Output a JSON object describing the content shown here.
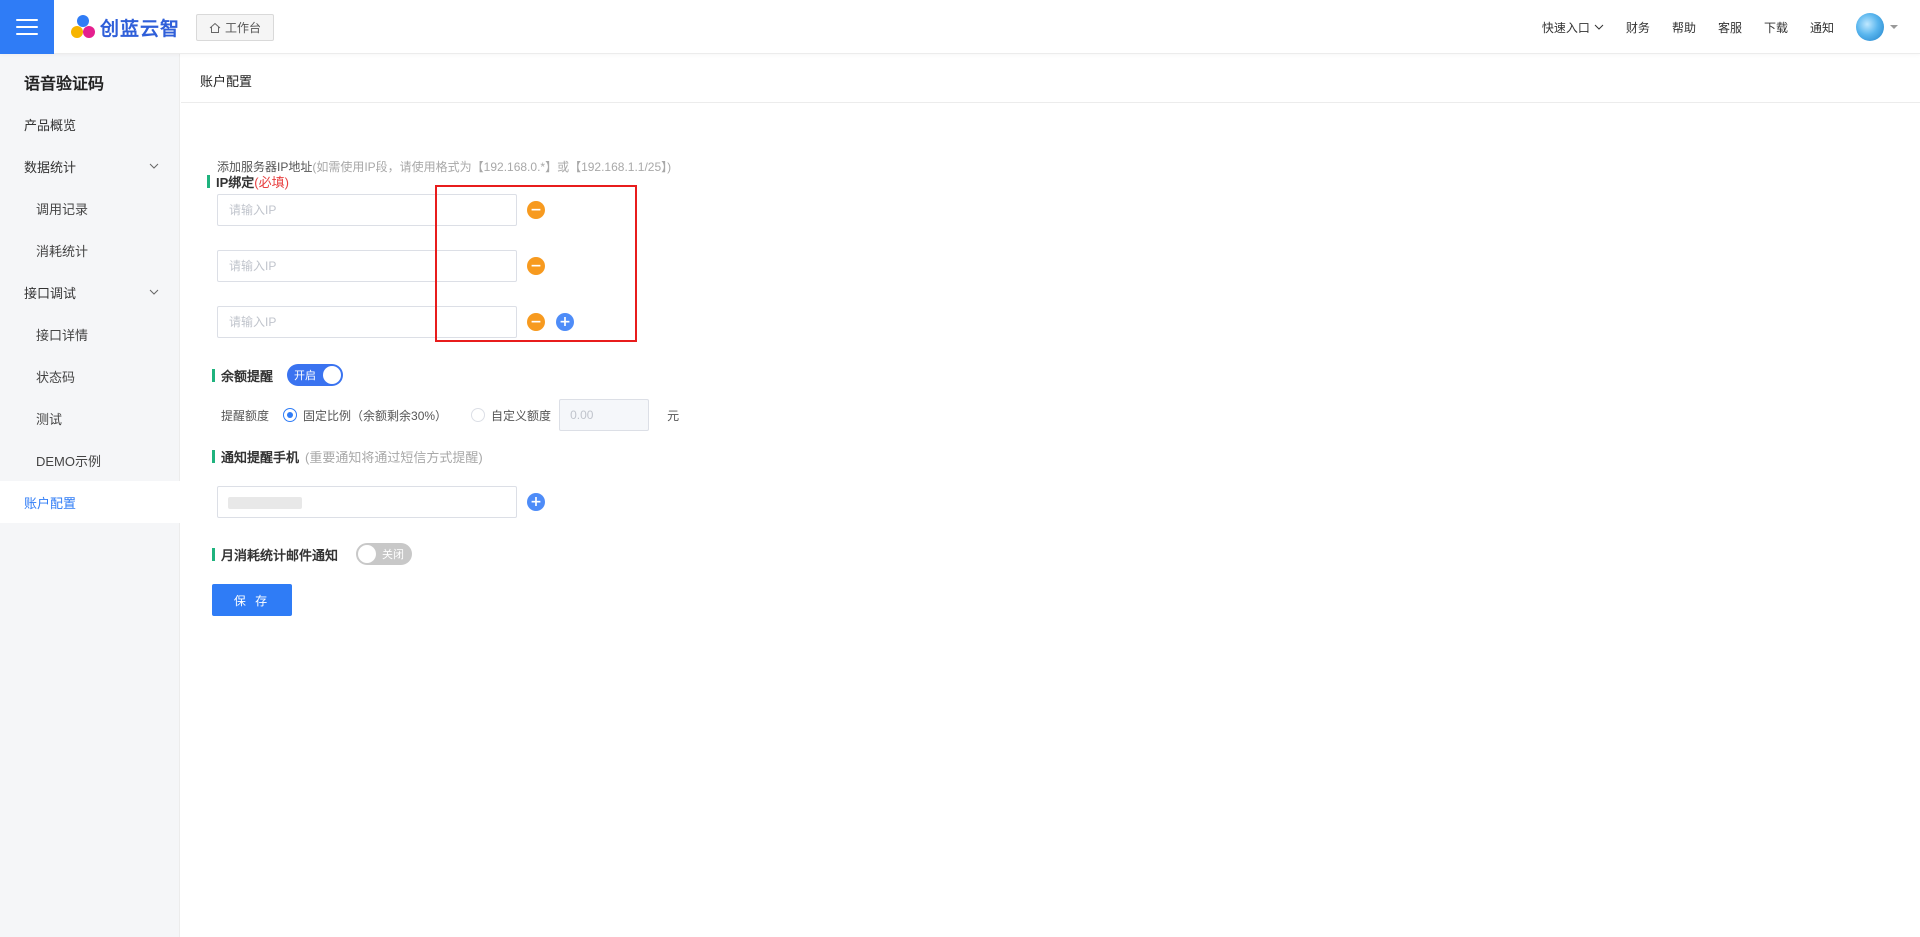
{
  "header": {
    "brand": "创蓝云智",
    "workbench_label": "工作台",
    "nav": {
      "quick_entry": "快速入口",
      "finance": "财务",
      "help": "帮助",
      "support": "客服",
      "download": "下载",
      "notice": "通知"
    }
  },
  "sidebar": {
    "title": "语音验证码",
    "items": [
      {
        "label": "产品概览"
      },
      {
        "label": "数据统计"
      },
      {
        "label": "调用记录"
      },
      {
        "label": "消耗统计"
      },
      {
        "label": "接口调试"
      },
      {
        "label": "接口详情"
      },
      {
        "label": "状态码"
      },
      {
        "label": "测试"
      },
      {
        "label": "DEMO示例"
      },
      {
        "label": "账户配置"
      }
    ]
  },
  "main": {
    "page_title": "账户配置",
    "ip_section": {
      "title": "IP绑定",
      "required": "(必填)",
      "helper": "添加服务器IP地址",
      "helper_hint": "(如需使用IP段，请使用格式为【192.168.0.*】或【192.168.1.1/25】)",
      "inputs": [
        {
          "value": "",
          "placeholder": "请输入IP"
        },
        {
          "value": "",
          "placeholder": "请输入IP"
        },
        {
          "value": "",
          "placeholder": "请输入IP"
        }
      ]
    },
    "balance_section": {
      "title": "余额提醒",
      "toggle_label": "开启",
      "enabled": true,
      "remind_label": "提醒额度",
      "option_fixed": "固定比例（余额剩余30%）",
      "option_custom": "自定义额度",
      "selected": "fixed",
      "amount_placeholder": "0.00",
      "unit": "元"
    },
    "phone_section": {
      "title": "通知提醒手机",
      "hint": "(重要通知将通过短信方式提醒)"
    },
    "email_section": {
      "title": "月消耗统计邮件通知",
      "toggle_label": "关闭",
      "enabled": false
    },
    "save_label": "保 存"
  },
  "colors": {
    "primary": "#2f7cf6",
    "accent_bar": "#1fb37e",
    "minus": "#f79a1f",
    "plus": "#4e8cf8",
    "required": "#e84040",
    "highlight": "#e81c1c"
  }
}
